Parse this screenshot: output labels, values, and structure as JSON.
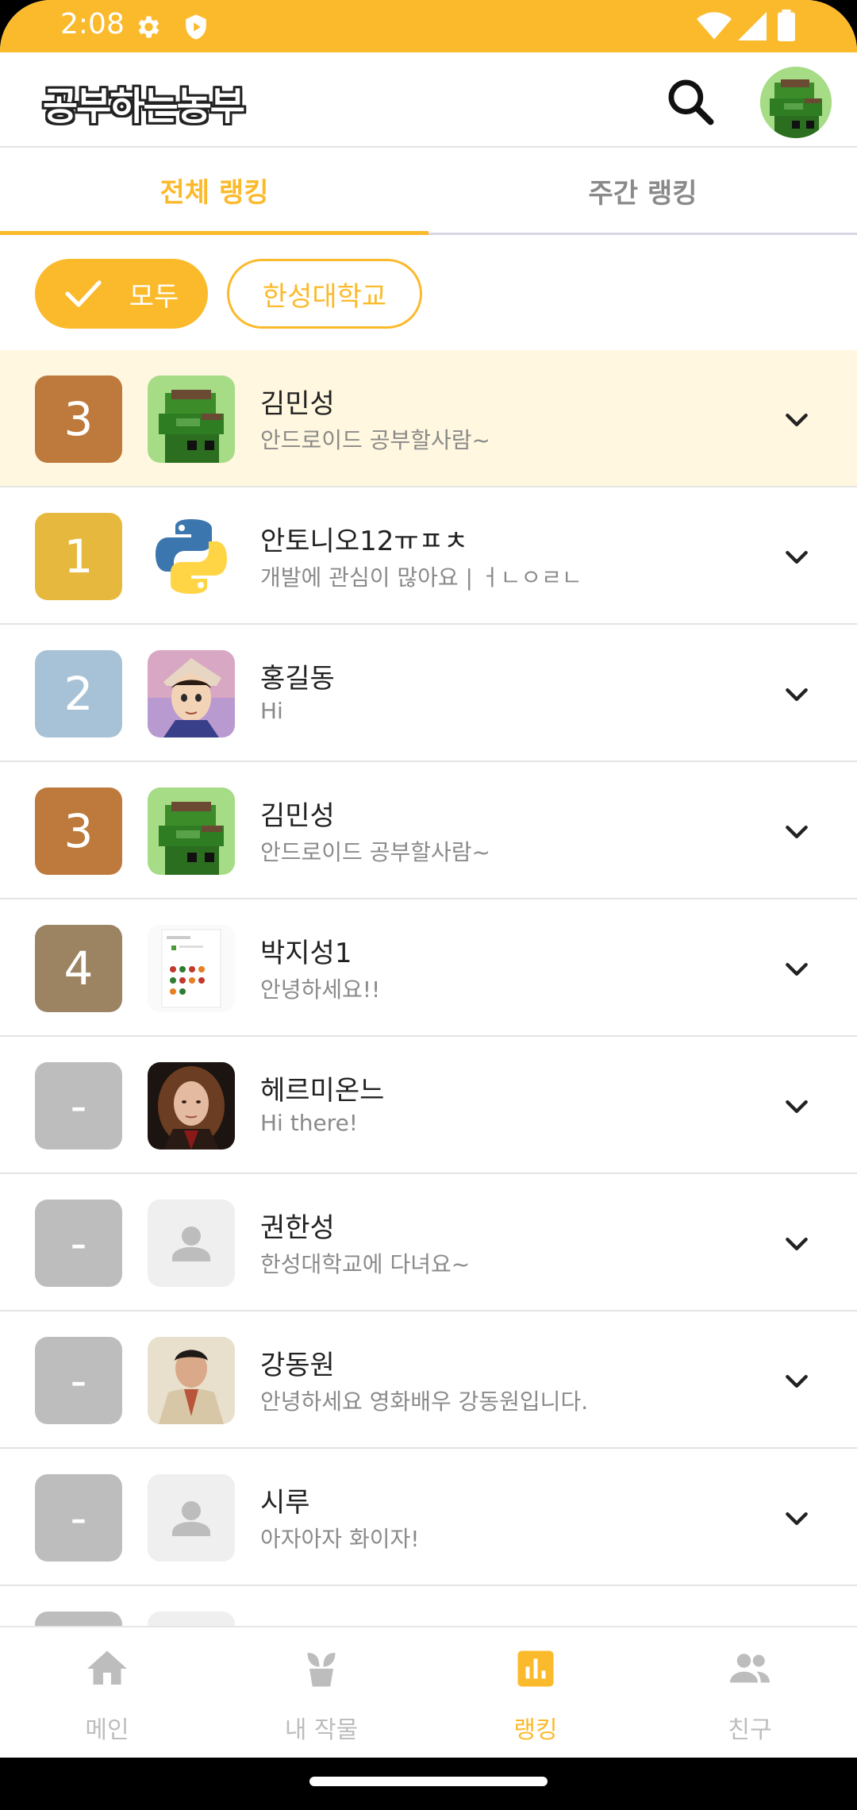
{
  "status_bar": {
    "time": "2:08",
    "icons": [
      "settings-icon",
      "shield-icon",
      "wifi-icon",
      "signal-icon",
      "battery-icon"
    ]
  },
  "app_bar": {
    "logo_text": "공부하는농부",
    "icons": [
      "search-icon",
      "profile-avatar"
    ]
  },
  "tabs": [
    {
      "label": "전체 랭킹",
      "active": true
    },
    {
      "label": "주간 랭킹",
      "active": false
    }
  ],
  "filters": [
    {
      "label": "모두",
      "selected": true
    },
    {
      "label": "한성대학교",
      "selected": false
    }
  ],
  "ranking": [
    {
      "rank": "3",
      "name": "김민성",
      "bio": "안드로이드 공부할사람~",
      "rank_color": "#BD7A3C",
      "avatar": "pixel-sprite",
      "highlight": true
    },
    {
      "rank": "1",
      "name": "안토니오12ㅠㅍㅊ",
      "bio": "개발에 관심이 많아요 | ㅓㄴㅇㄹㄴ",
      "rank_color": "#E6B93E",
      "avatar": "python-logo",
      "highlight": false
    },
    {
      "rank": "2",
      "name": "홍길동",
      "bio": "Hi",
      "rank_color": "#A7C2D6",
      "avatar": "anime-portrait",
      "highlight": false
    },
    {
      "rank": "3",
      "name": "김민성",
      "bio": "안드로이드 공부할사람~",
      "rank_color": "#BD7A3C",
      "avatar": "pixel-sprite",
      "highlight": false
    },
    {
      "rank": "4",
      "name": "박지성1",
      "bio": "안녕하세요!!",
      "rank_color": "#9C8463",
      "avatar": "screenshot-thumb",
      "highlight": false
    },
    {
      "rank": "-",
      "name": "헤르미온느",
      "bio": "Hi there!",
      "rank_color": "#BDBDBD",
      "avatar": "photo-portrait",
      "highlight": false
    },
    {
      "rank": "-",
      "name": "권한성",
      "bio": "한성대학교에 다녀요~",
      "rank_color": "#BDBDBD",
      "avatar": "default-person",
      "highlight": false
    },
    {
      "rank": "-",
      "name": "강동원",
      "bio": "안녕하세요 영화배우 강동원입니다.",
      "rank_color": "#BDBDBD",
      "avatar": "photo-man",
      "highlight": false
    },
    {
      "rank": "-",
      "name": "시루",
      "bio": "아자아자 화이자!",
      "rank_color": "#BDBDBD",
      "avatar": "default-person",
      "highlight": false
    },
    {
      "rank": "-",
      "name": "",
      "bio": "",
      "rank_color": "#BDBDBD",
      "avatar": "default-person",
      "highlight": false
    }
  ],
  "bottom_nav": [
    {
      "label": "메인",
      "icon": "home-icon",
      "active": false
    },
    {
      "label": "내 작물",
      "icon": "sprout-icon",
      "active": false
    },
    {
      "label": "랭킹",
      "icon": "ranking-chart-icon",
      "active": true
    },
    {
      "label": "친구",
      "icon": "friends-icon",
      "active": false
    }
  ],
  "colors": {
    "accent": "#FBBA2C",
    "highlight_row": "#FFF7DF",
    "inactive": "#BDBDBD"
  }
}
